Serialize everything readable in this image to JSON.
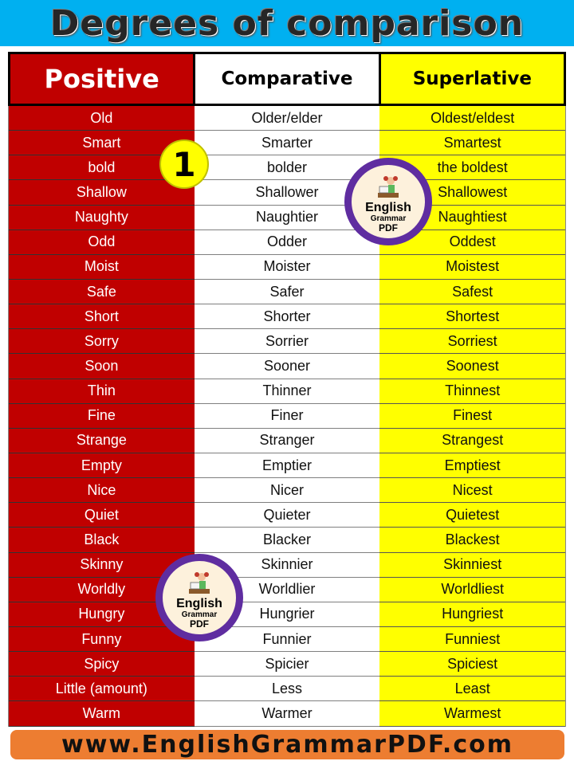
{
  "title": "Degrees of comparison",
  "table": {
    "headers": {
      "positive": "Positive",
      "comparative": "Comparative",
      "superlative": "Superlative"
    },
    "rows": [
      [
        "Old",
        "Older/elder",
        "Oldest/eldest"
      ],
      [
        "Smart",
        "Smarter",
        "Smartest"
      ],
      [
        "bold",
        "bolder",
        "the boldest"
      ],
      [
        "Shallow",
        "Shallower",
        "Shallowest"
      ],
      [
        "Naughty",
        "Naughtier",
        "Naughtiest"
      ],
      [
        "Odd",
        "Odder",
        "Oddest"
      ],
      [
        "Moist",
        "Moister",
        "Moistest"
      ],
      [
        "Safe",
        "Safer",
        "Safest"
      ],
      [
        "Short",
        "Shorter",
        "Shortest"
      ],
      [
        "Sorry",
        "Sorrier",
        "Sorriest"
      ],
      [
        "Soon",
        "Sooner",
        "Soonest"
      ],
      [
        "Thin",
        "Thinner",
        "Thinnest"
      ],
      [
        "Fine",
        "Finer",
        "Finest"
      ],
      [
        "Strange",
        "Stranger",
        "Strangest"
      ],
      [
        "Empty",
        "Emptier",
        "Emptiest"
      ],
      [
        "Nice",
        "Nicer",
        "Nicest"
      ],
      [
        "Quiet",
        "Quieter",
        "Quietest"
      ],
      [
        "Black",
        "Blacker",
        "Blackest"
      ],
      [
        "Skinny",
        "Skinnier",
        "Skinniest"
      ],
      [
        "Worldly",
        "Worldlier",
        "Worldliest"
      ],
      [
        "Hungry",
        "Hungrier",
        "Hungriest"
      ],
      [
        "Funny",
        "Funnier",
        "Funniest"
      ],
      [
        "Spicy",
        "Spicier",
        "Spiciest"
      ],
      [
        "Little (amount)",
        "Less",
        "Least"
      ],
      [
        "Warm",
        "Warmer",
        "Warmest"
      ]
    ]
  },
  "page_badge": "1",
  "logo": {
    "line1": "English",
    "line2": "Grammar",
    "line3": "PDF"
  },
  "footer": "www.EnglishGrammarPDF.com",
  "colors": {
    "title_bg": "#00b0f0",
    "positive": "#c00000",
    "comparative": "#ffffff",
    "superlative": "#ffff00",
    "footer_bg": "#ed7d31",
    "logo_ring": "#5f2da0"
  }
}
